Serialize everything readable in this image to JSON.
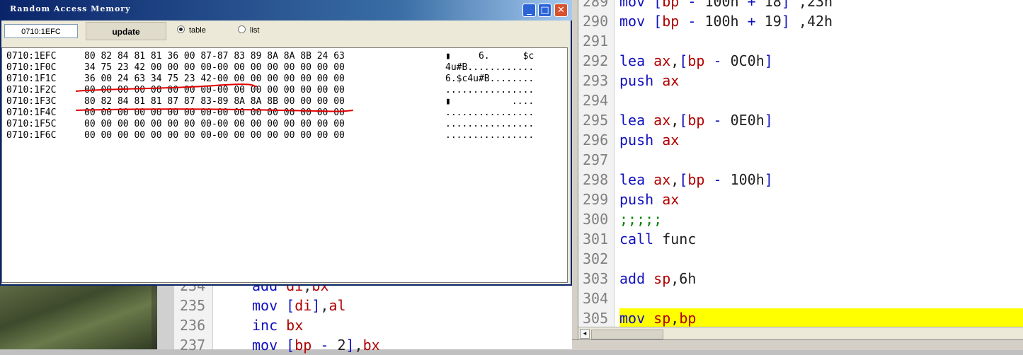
{
  "ram_window": {
    "title": "Random Access Memory",
    "address_value": "0710:1EFC",
    "update_label": "update",
    "radio_table_label": "table",
    "radio_list_label": "list",
    "selected_view": "table",
    "rows": [
      {
        "addr": "0710:1EFC",
        "hex": "80 82 84 81 81 36 00 87-87 83 89 8A 8A 8B 24 63",
        "ascii": "▮     6.      $c"
      },
      {
        "addr": "0710:1F0C",
        "hex": "34 75 23 42 00 00 00 00-00 00 00 00 00 00 00 00",
        "ascii": "4u#B............"
      },
      {
        "addr": "0710:1F1C",
        "hex": "36 00 24 63 34 75 23 42-00 00 00 00 00 00 00 00",
        "ascii": "6.$c4u#B........"
      },
      {
        "addr": "0710:1F2C",
        "hex": "00 00 00 00 00 00 00 00-00 00 00 00 00 00 00 00",
        "ascii": "................"
      },
      {
        "addr": "0710:1F3C",
        "hex": "80 82 84 81 81 87 87 83-89 8A 8A 8B 00 00 00 00",
        "ascii": "▮           ...."
      },
      {
        "addr": "0710:1F4C",
        "hex": "00 00 00 00 00 00 00 00-00 00 00 00 00 00 00 00",
        "ascii": "................"
      },
      {
        "addr": "0710:1F5C",
        "hex": "00 00 00 00 00 00 00 00-00 00 00 00 00 00 00 00",
        "ascii": "................"
      },
      {
        "addr": "0710:1F6C",
        "hex": "00 00 00 00 00 00 00 00-00 00 00 00 00 00 00 00",
        "ascii": "................"
      }
    ],
    "title_colors": {
      "start": "#0a246a",
      "end": "#a6caf0"
    },
    "annotation_color": "#e00000"
  },
  "right_editor": {
    "lines": [
      {
        "num": "289",
        "tokens": [
          {
            "t": "mov ",
            "c": "kw"
          },
          {
            "t": "[",
            "c": "pn"
          },
          {
            "t": "bp",
            "c": "rg"
          },
          {
            "t": " - ",
            "c": "pn"
          },
          {
            "t": "100h",
            "c": "nm"
          },
          {
            "t": " + ",
            "c": "pn"
          },
          {
            "t": "18",
            "c": "nm"
          },
          {
            "t": "]",
            "c": "pn"
          },
          {
            "t": " ,23h",
            "c": "nm"
          }
        ]
      },
      {
        "num": "290",
        "tokens": [
          {
            "t": "mov ",
            "c": "kw"
          },
          {
            "t": "[",
            "c": "pn"
          },
          {
            "t": "bp",
            "c": "rg"
          },
          {
            "t": " - ",
            "c": "pn"
          },
          {
            "t": "100h",
            "c": "nm"
          },
          {
            "t": " + ",
            "c": "pn"
          },
          {
            "t": "19",
            "c": "nm"
          },
          {
            "t": "]",
            "c": "pn"
          },
          {
            "t": " ,42h",
            "c": "nm"
          }
        ]
      },
      {
        "num": "291",
        "tokens": []
      },
      {
        "num": "292",
        "tokens": [
          {
            "t": "lea ",
            "c": "kw"
          },
          {
            "t": "ax",
            "c": "rg"
          },
          {
            "t": ",",
            "c": "nm"
          },
          {
            "t": "[",
            "c": "pn"
          },
          {
            "t": "bp",
            "c": "rg"
          },
          {
            "t": " - ",
            "c": "pn"
          },
          {
            "t": "0C0h",
            "c": "nm"
          },
          {
            "t": "]",
            "c": "pn"
          }
        ]
      },
      {
        "num": "293",
        "tokens": [
          {
            "t": "push ",
            "c": "kw"
          },
          {
            "t": "ax",
            "c": "rg"
          }
        ]
      },
      {
        "num": "294",
        "tokens": []
      },
      {
        "num": "295",
        "tokens": [
          {
            "t": "lea ",
            "c": "kw"
          },
          {
            "t": "ax",
            "c": "rg"
          },
          {
            "t": ",",
            "c": "nm"
          },
          {
            "t": "[",
            "c": "pn"
          },
          {
            "t": "bp",
            "c": "rg"
          },
          {
            "t": " - ",
            "c": "pn"
          },
          {
            "t": "0E0h",
            "c": "nm"
          },
          {
            "t": "]",
            "c": "pn"
          }
        ]
      },
      {
        "num": "296",
        "tokens": [
          {
            "t": "push ",
            "c": "kw"
          },
          {
            "t": "ax",
            "c": "rg"
          }
        ]
      },
      {
        "num": "297",
        "tokens": []
      },
      {
        "num": "298",
        "tokens": [
          {
            "t": "lea ",
            "c": "kw"
          },
          {
            "t": "ax",
            "c": "rg"
          },
          {
            "t": ",",
            "c": "nm"
          },
          {
            "t": "[",
            "c": "pn"
          },
          {
            "t": "bp",
            "c": "rg"
          },
          {
            "t": " - ",
            "c": "pn"
          },
          {
            "t": "100h",
            "c": "nm"
          },
          {
            "t": "]",
            "c": "pn"
          }
        ]
      },
      {
        "num": "299",
        "tokens": [
          {
            "t": "push ",
            "c": "kw"
          },
          {
            "t": "ax",
            "c": "rg"
          }
        ]
      },
      {
        "num": "300",
        "tokens": [
          {
            "t": ";;;;;",
            "c": "cm"
          }
        ]
      },
      {
        "num": "301",
        "tokens": [
          {
            "t": "call ",
            "c": "kw"
          },
          {
            "t": "func",
            "c": "nm"
          }
        ]
      },
      {
        "num": "302",
        "tokens": []
      },
      {
        "num": "303",
        "tokens": [
          {
            "t": "add ",
            "c": "kw"
          },
          {
            "t": "sp",
            "c": "rg"
          },
          {
            "t": ",6h",
            "c": "nm"
          }
        ]
      },
      {
        "num": "304",
        "tokens": []
      },
      {
        "num": "305",
        "tokens": [
          {
            "t": "mov ",
            "c": "kw"
          },
          {
            "t": "sp",
            "c": "rg"
          },
          {
            "t": ",",
            "c": "nm"
          },
          {
            "t": "bp",
            "c": "rg"
          }
        ],
        "highlight": true
      }
    ],
    "highlight_color": "#ffff00"
  },
  "left_editor": {
    "lines": [
      {
        "num": "234",
        "tokens": [
          {
            "t": "add ",
            "c": "kw"
          },
          {
            "t": "di",
            "c": "rg"
          },
          {
            "t": ",",
            "c": "nm"
          },
          {
            "t": "bx",
            "c": "rg"
          }
        ]
      },
      {
        "num": "235",
        "tokens": [
          {
            "t": "mov ",
            "c": "kw"
          },
          {
            "t": "[",
            "c": "pn"
          },
          {
            "t": "di",
            "c": "rg"
          },
          {
            "t": "]",
            "c": "pn"
          },
          {
            "t": ",",
            "c": "nm"
          },
          {
            "t": "al",
            "c": "rg"
          }
        ]
      },
      {
        "num": "236",
        "tokens": [
          {
            "t": "inc ",
            "c": "kw"
          },
          {
            "t": "bx",
            "c": "rg"
          }
        ]
      },
      {
        "num": "237",
        "tokens": [
          {
            "t": "mov ",
            "c": "kw"
          },
          {
            "t": "[",
            "c": "pn"
          },
          {
            "t": "bp",
            "c": "rg"
          },
          {
            "t": " - ",
            "c": "pn"
          },
          {
            "t": "2",
            "c": "nm"
          },
          {
            "t": "]",
            "c": "pn"
          },
          {
            "t": ",",
            "c": "nm"
          },
          {
            "t": "bx",
            "c": "rg"
          }
        ]
      }
    ]
  }
}
